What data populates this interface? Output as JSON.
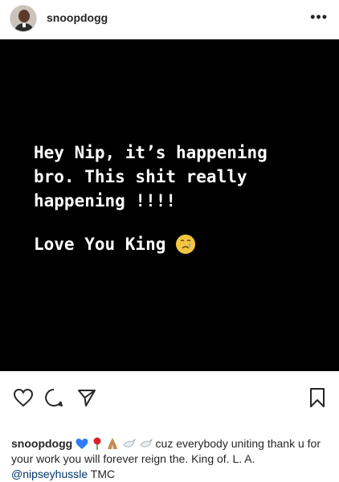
{
  "header": {
    "username": "snoopdogg",
    "more_label": "•••"
  },
  "post": {
    "lines": "Hey Nip, it’s happening\nbro. This shit really\nhappening !!!!",
    "line2": "Love You King"
  },
  "icons": {
    "like": "heart-outline-icon",
    "comment": "comment-icon",
    "share": "paper-plane-icon",
    "save": "bookmark-icon"
  },
  "caption": {
    "username": "snoopdogg",
    "text_1": " cuz everybody uniting thank u for your work you will forever reign the. King of.  L. A.",
    "mention": "@nipseyhussle",
    "text_2": " TMC"
  }
}
